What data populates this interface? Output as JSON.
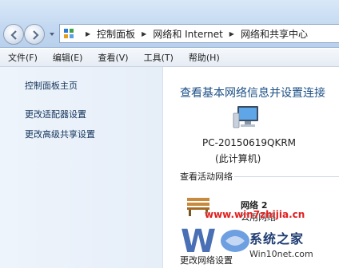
{
  "address_bar": {
    "breadcrumbs": [
      "控制面板",
      "网络和 Internet",
      "网络和共享中心"
    ]
  },
  "menu": {
    "items": [
      "文件(F)",
      "编辑(E)",
      "查看(V)",
      "工具(T)",
      "帮助(H)"
    ]
  },
  "sidebar": {
    "links": [
      "控制面板主页",
      "更改适配器设置",
      "更改高级共享设置"
    ]
  },
  "main": {
    "title": "查看基本网络信息并设置连接",
    "computer_name": "PC-20150619QKRM",
    "computer_sub": "(此计算机)",
    "active_networks_label": "查看活动网络",
    "network_name": "网络  2",
    "network_type": "公用网络",
    "change_settings_label": "更改网络设置"
  },
  "watermark": {
    "site_url": "www.win7zhijia.cn",
    "brand_name": "系统之家",
    "brand_url": "Win10net.com"
  },
  "colors": {
    "title_blue": "#1b4f86",
    "link_blue": "#12335b",
    "watermark_red": "#e02020"
  }
}
